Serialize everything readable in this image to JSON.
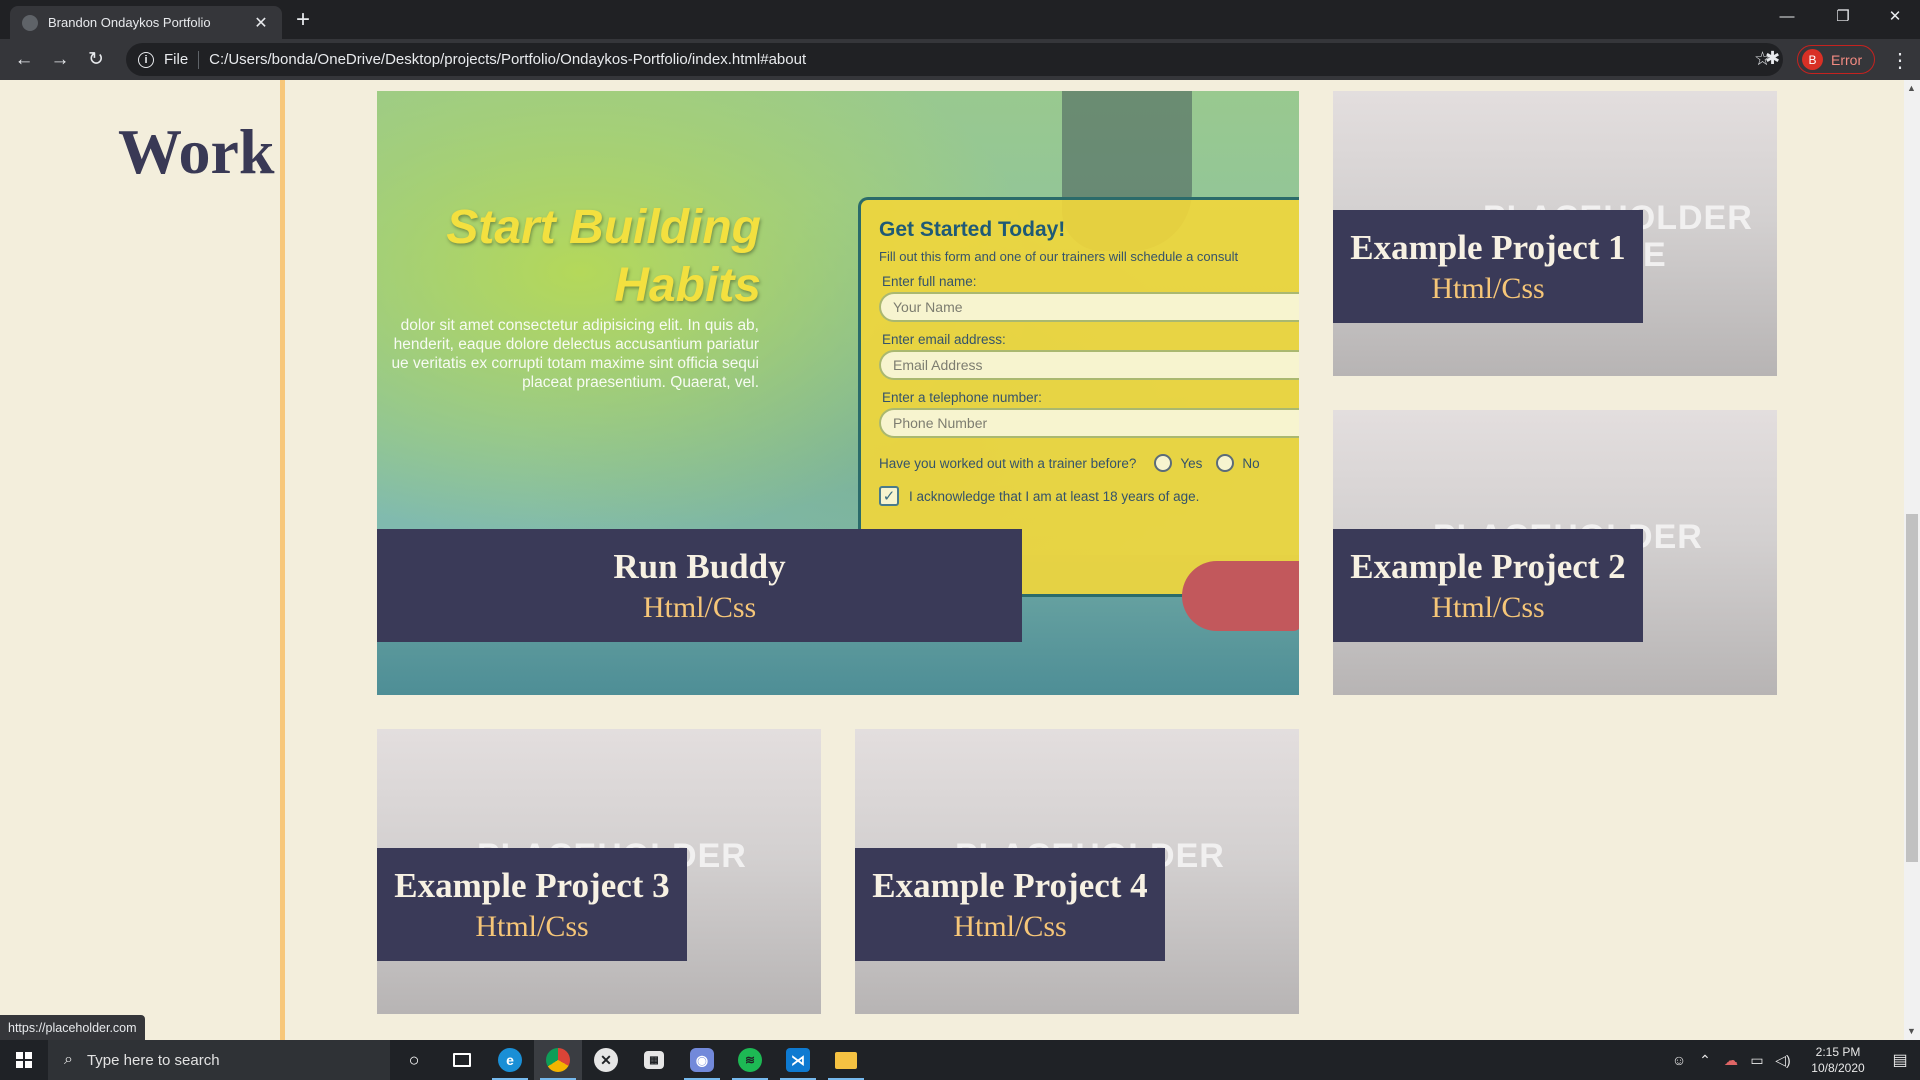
{
  "browser": {
    "tab_title": "Brandon Ondaykos Portfolio",
    "tab_close": "✕",
    "new_tab": "+",
    "window_minimize": "—",
    "window_restore": "❐",
    "window_close": "✕",
    "nav_back": "←",
    "nav_forward": "→",
    "nav_reload": "↻",
    "scheme_label": "File",
    "url": "C:/Users/bonda/OneDrive/Desktop/projects/Portfolio/Ondaykos-Portfolio/index.html#about",
    "bookmark_star": "☆",
    "extensions": "✱",
    "profile_initial": "B",
    "profile_status": "Error",
    "menu": "⋮",
    "status_url": "https://placeholder.com"
  },
  "page": {
    "section_heading": "Work",
    "feature": {
      "headline_line1": "Start Building",
      "headline_line2": "Habits",
      "lorem": "dolor sit amet consectetur adipisicing elit. In quis ab,\nhenderit, eaque dolore delectus accusantium pariatur\nue veritatis ex corrupti totam maxime sint officia sequi\nplaceat praesentium. Quaerat, vel.",
      "form": {
        "title": "Get Started Today!",
        "description": "Fill out this form and one of our trainers will schedule a consult",
        "name_label": "Enter full name:",
        "name_placeholder": "Your Name",
        "email_label": "Enter email address:",
        "email_placeholder": "Email Address",
        "phone_label": "Enter a telephone number:",
        "phone_placeholder": "Phone Number",
        "trainer_question": "Have you worked out with a trainer before?",
        "yes": "Yes",
        "no": "No",
        "age_ack": "I acknowledge that I am at least 18 years of age.",
        "check_mark": "✓"
      },
      "project_title": "Run Buddy",
      "project_stack": "Html/Css"
    },
    "projects": [
      {
        "title": "Example Project 1",
        "stack": "Html/Css",
        "placeholder_fragment_a": "LDER",
        "placeholder_fragment_b": "E"
      },
      {
        "title": "Example Project 2",
        "stack": "Html/Css",
        "placeholder_fragment_a": "ER"
      },
      {
        "title": "Example Project 3",
        "stack": "Html/Css",
        "placeholder_fragment_a": "ER"
      },
      {
        "title": "Example Project 4",
        "stack": "Html/Css",
        "placeholder_fragment_a": "ER"
      }
    ]
  },
  "taskbar": {
    "search_placeholder": "Type here to search",
    "search_icon": "⌕",
    "task_view": "○",
    "clock_time": "2:15 PM",
    "clock_date": "10/8/2020",
    "tray_people": "☺",
    "tray_chevron": "⌃",
    "tray_network": "▭",
    "tray_volume": "◁)",
    "tray_notifications": "▤"
  },
  "colors": {
    "page_bg": "#f3eedc",
    "heading": "#393955",
    "label_bg": "#3a3a58",
    "label_title": "#f7f1e3",
    "label_stack": "#f6c678",
    "divider": "#f7c77a"
  }
}
